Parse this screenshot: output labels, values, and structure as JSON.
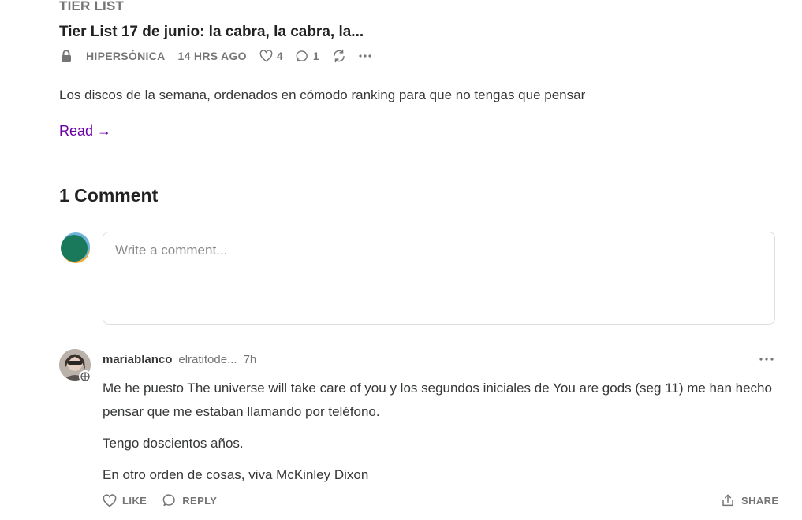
{
  "post": {
    "section_label": "TIER LIST",
    "title": "Tier List 17 de junio: la cabra, la cabra, la...",
    "publication": "HIPERSÓNICA",
    "time": "14 HRS AGO",
    "likes": "4",
    "comments": "1",
    "subtitle": "Los discos de la semana, ordenados en cómodo ranking para que no tengas que pensar",
    "read_label": "Read →"
  },
  "comments_section": {
    "heading": "1 Comment",
    "input_placeholder": "Write a comment...",
    "input_value": ""
  },
  "comment": {
    "user": "mariablanco",
    "handle": "elratitode...",
    "time": "7h",
    "paragraphs": [
      "Me he puesto The universe will take care of you y los segundos iniciales de You are gods (seg 11) me han hecho pensar que me estaban llamando por teléfono.",
      "Tengo doscientos años.",
      "En otro orden de cosas, viva McKinley Dixon"
    ],
    "like_label": "LIKE",
    "reply_label": "REPLY",
    "share_label": "SHARE"
  },
  "icons": {
    "lock": "lock-icon",
    "heart": "heart-icon",
    "comment": "comment-bubble-icon",
    "restack": "restack-icon",
    "more": "more-dots-icon",
    "share": "share-icon"
  },
  "colors": {
    "link": "#6b00a6",
    "muted": "#757575",
    "text": "#363737"
  }
}
